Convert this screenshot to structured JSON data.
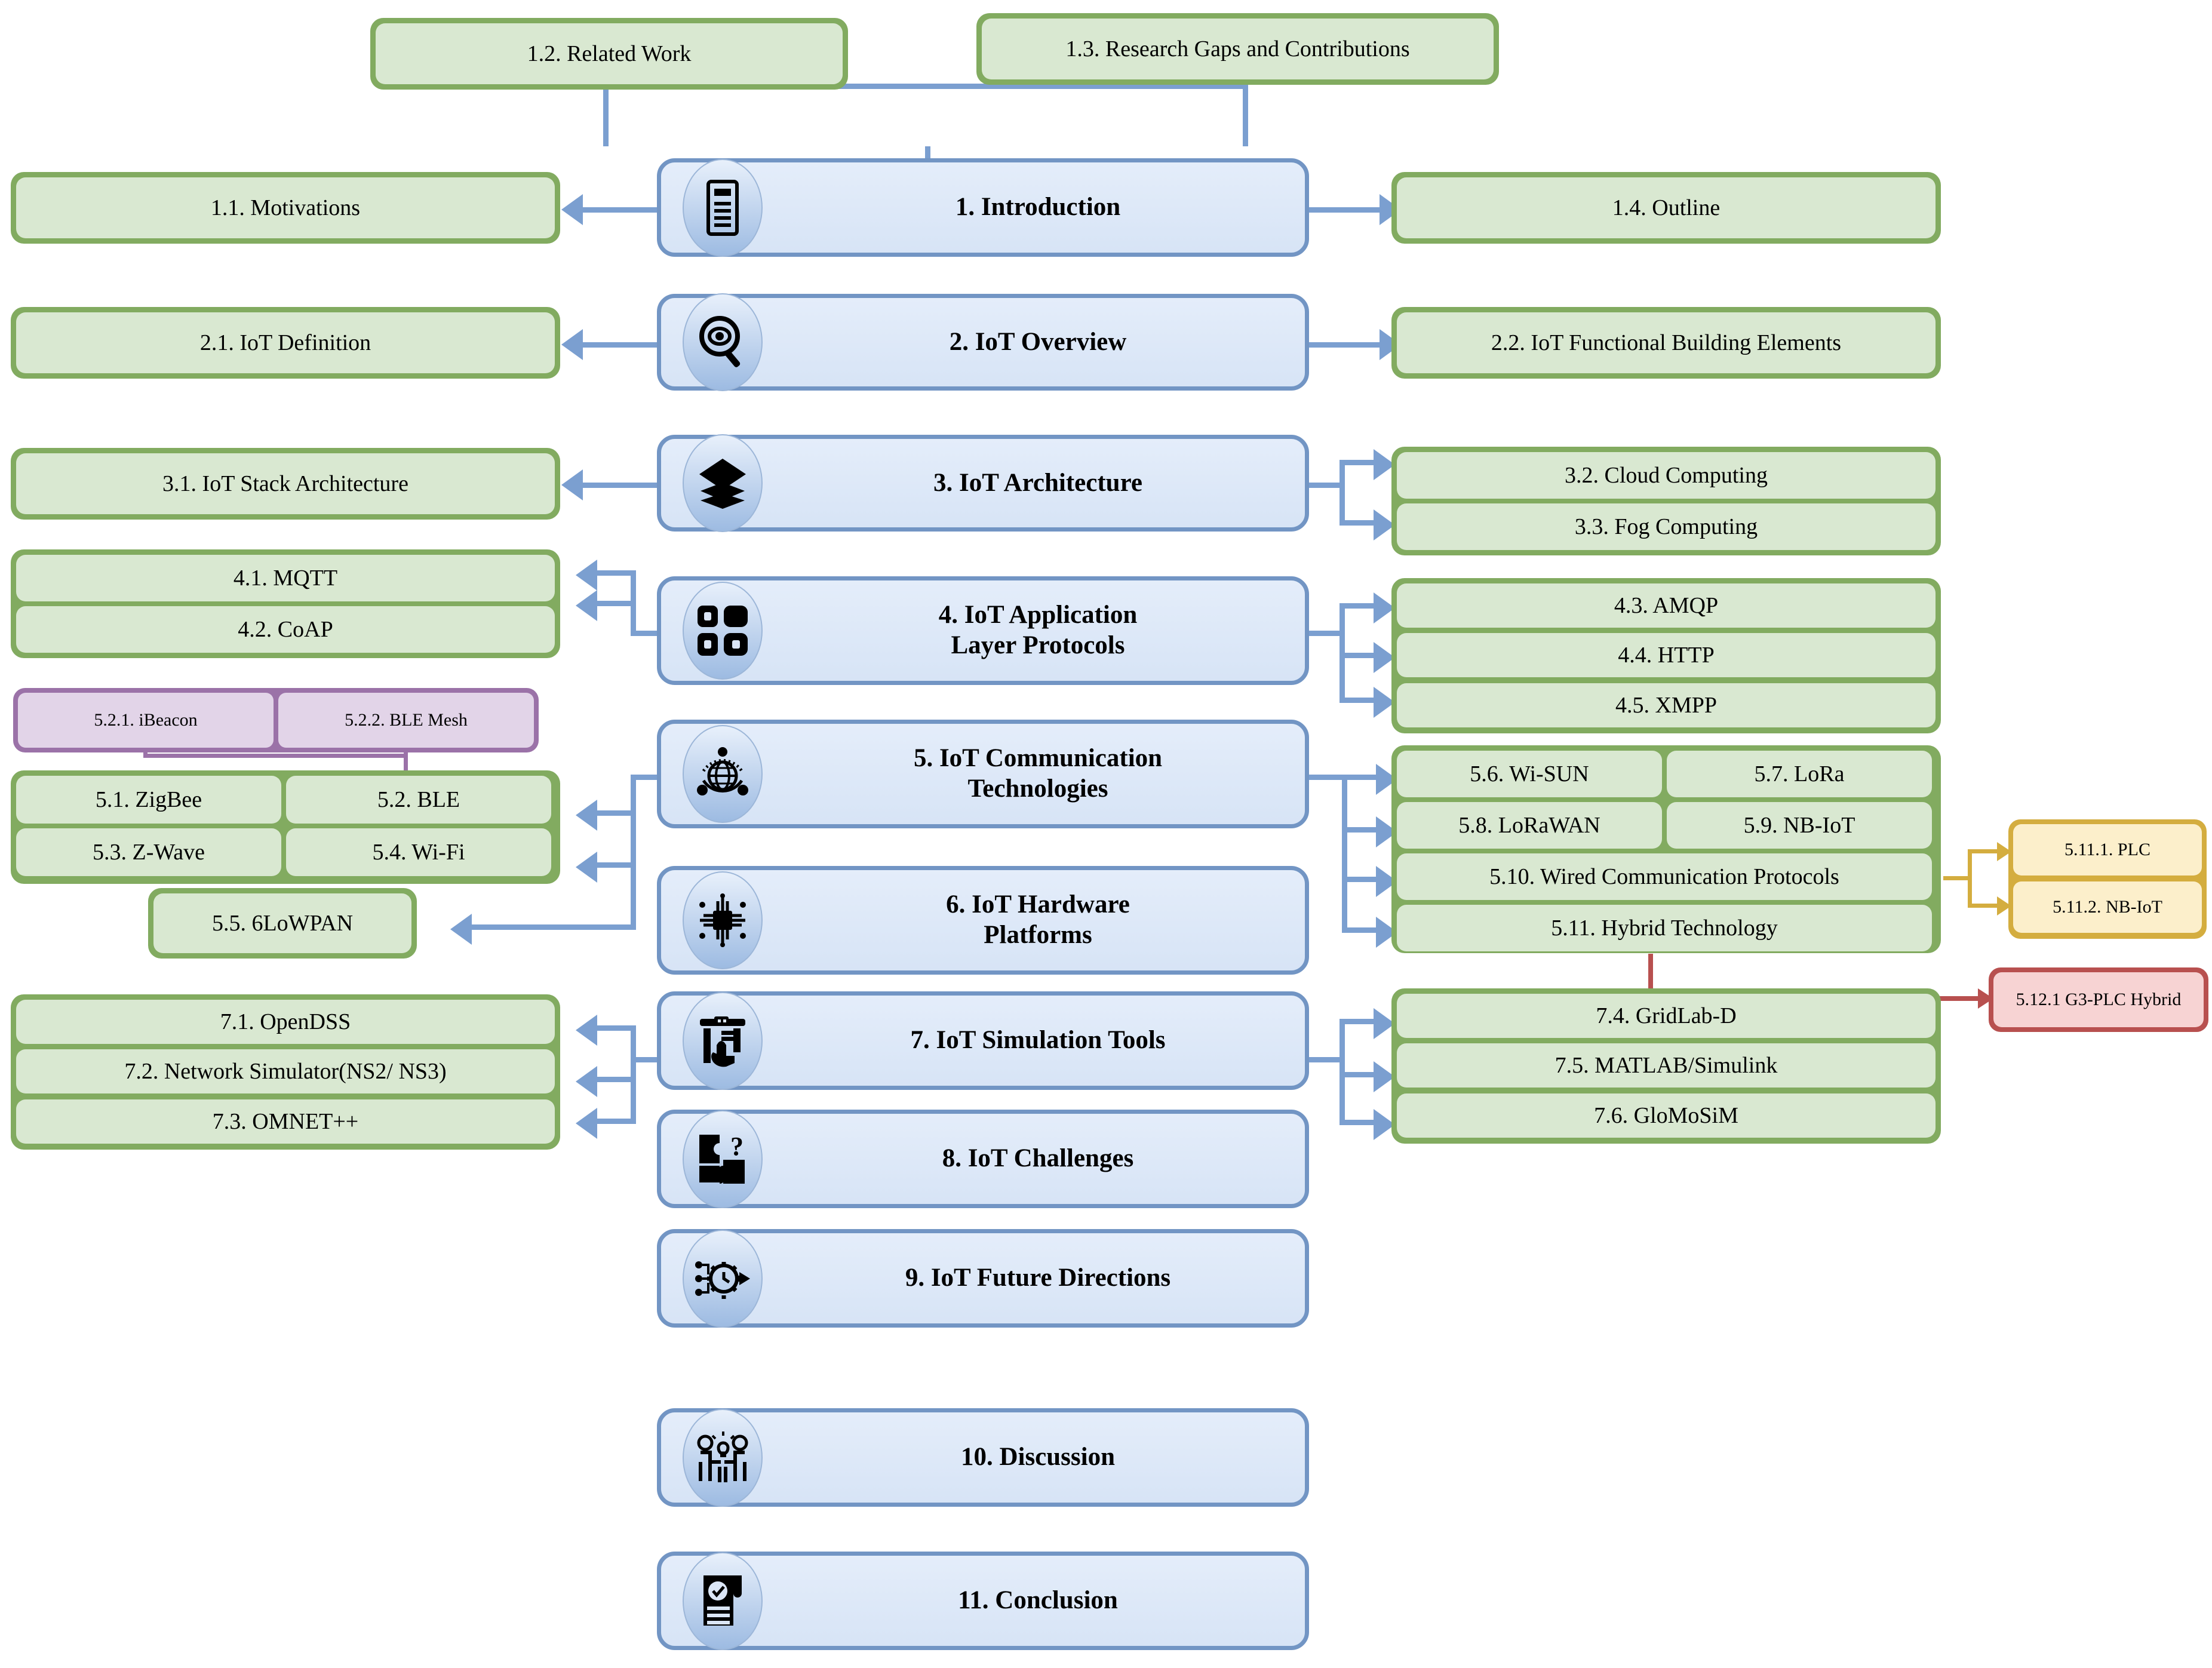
{
  "diagram": {
    "title": "IoT Survey Paper Outline Flow Diagram",
    "colors": {
      "green_border": "#82ab60",
      "green_fill": "#d9e8d1",
      "blue_border": "#7295c4",
      "blue_fill": "#dce7f7",
      "purple_border": "#9b72a8",
      "purple_fill": "#e2d4e8",
      "yellow_border": "#d4ad3f",
      "yellow_fill": "#fcefcb",
      "red_border": "#b8504f",
      "red_fill": "#f7d3d3",
      "connector_blue": "#7b9fd0"
    }
  },
  "main_sections": [
    {
      "id": "s1",
      "label": "1. Introduction",
      "icon": "document-list-icon"
    },
    {
      "id": "s2",
      "label": "2. IoT Overview",
      "icon": "magnifier-eye-icon"
    },
    {
      "id": "s3",
      "label": "3. IoT Architecture",
      "icon": "layers-stack-icon"
    },
    {
      "id": "s4",
      "label": "4. IoT Application\nLayer Protocols",
      "icon": "four-blocks-icon"
    },
    {
      "id": "s5",
      "label": "5. IoT Communication\nTechnologies",
      "icon": "globe-network-icon"
    },
    {
      "id": "s6",
      "label": "6. IoT Hardware\nPlatforms",
      "icon": "microchip-icon"
    },
    {
      "id": "s7",
      "label": "7. IoT Simulation Tools",
      "icon": "simulation-hand-icon"
    },
    {
      "id": "s8",
      "label": "8. IoT Challenges",
      "icon": "puzzle-question-icon"
    },
    {
      "id": "s9",
      "label": "9. IoT Future Directions",
      "icon": "future-gear-arrow-icon"
    },
    {
      "id": "s10",
      "label": "10. Discussion",
      "icon": "people-idea-icon"
    },
    {
      "id": "s11",
      "label": "11. Conclusion",
      "icon": "scroll-check-icon"
    }
  ],
  "subsections": {
    "top_left": {
      "label": "1.2. Related Work"
    },
    "top_right": {
      "label": "1.3. Research Gaps and Contributions"
    },
    "s1_left": {
      "label": "1.1. Motivations"
    },
    "s1_right": {
      "label": "1.4. Outline"
    },
    "s2_left": {
      "label": "2.1. IoT Definition"
    },
    "s2_right": {
      "label": "2.2. IoT Functional Building Elements"
    },
    "s3_left": {
      "label": "3.1. IoT Stack Architecture"
    },
    "s3_right": [
      {
        "label": "3.2. Cloud Computing"
      },
      {
        "label": "3.3. Fog Computing"
      }
    ],
    "s4_left": [
      {
        "label": "4.1. MQTT"
      },
      {
        "label": "4.2. CoAP"
      }
    ],
    "s4_right": [
      {
        "label": "4.3. AMQP"
      },
      {
        "label": "4.4. HTTP"
      },
      {
        "label": "4.5. XMPP"
      }
    ],
    "s5_purple": [
      {
        "label": "5.2.1. iBeacon"
      },
      {
        "label": "5.2.2. BLE Mesh"
      }
    ],
    "s5_left": [
      {
        "label": "5.1. ZigBee"
      },
      {
        "label": "5.2. BLE"
      },
      {
        "label": "5.3. Z-Wave"
      },
      {
        "label": "5.4. Wi-Fi"
      }
    ],
    "s5_left_wide": {
      "label": "5.5. 6LoWPAN"
    },
    "s5_right": [
      {
        "label": "5.6. Wi-SUN"
      },
      {
        "label": "5.7. LoRa"
      },
      {
        "label": "5.8. LoRaWAN"
      },
      {
        "label": "5.9. NB-IoT"
      }
    ],
    "s5_right_wide": [
      {
        "label": "5.10. Wired Communication Protocols"
      },
      {
        "label": "5.11. Hybrid Technology"
      }
    ],
    "s5_yellow": [
      {
        "label": "5.11.1. PLC"
      },
      {
        "label": "5.11.2. NB-IoT"
      }
    ],
    "s5_red": {
      "label": "5.12.1 G3-PLC Hybrid"
    },
    "s7_left": [
      {
        "label": "7.1. OpenDSS"
      },
      {
        "label": "7.2. Network Simulator(NS2/ NS3)"
      },
      {
        "label": "7.3. OMNET++"
      }
    ],
    "s7_right": [
      {
        "label": "7.4. GridLab-D"
      },
      {
        "label": "7.5. MATLAB/Simulink"
      },
      {
        "label": "7.6. GloMoSiM"
      }
    ]
  }
}
